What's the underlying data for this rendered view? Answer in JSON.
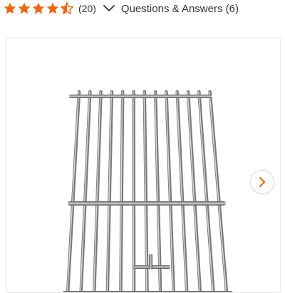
{
  "rating": {
    "value": 4.5,
    "max": 5,
    "review_count": "(20)",
    "star_color": "#f96302"
  },
  "qa": {
    "label": "Questions & Answers (6)",
    "icon": "chevron-down-icon"
  },
  "gallery": {
    "image_alt": "stainless steel cooking grate",
    "next_icon": "chevron-right-icon",
    "accent": "#f96302"
  }
}
